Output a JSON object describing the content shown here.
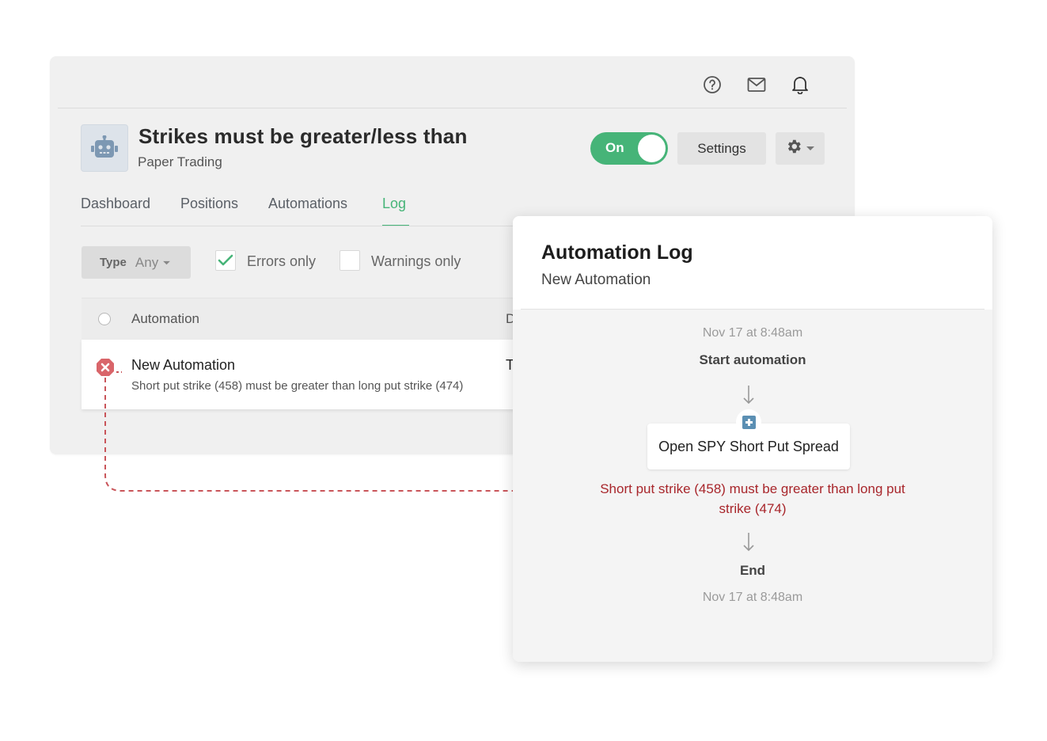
{
  "strategy": {
    "title": "Strikes must be greater/less than",
    "subtitle": "Paper Trading",
    "toggle_label": "On",
    "settings_label": "Settings"
  },
  "topbar": {
    "icons": [
      "help-circle-icon",
      "mail-icon",
      "bell-icon"
    ]
  },
  "tabs": [
    {
      "label": "Dashboard",
      "active": false
    },
    {
      "label": "Positions",
      "active": false
    },
    {
      "label": "Automations",
      "active": false
    },
    {
      "label": "Log",
      "active": true
    }
  ],
  "filters": {
    "type_key": "Type",
    "type_value": "Any",
    "errors_only": {
      "label": "Errors only",
      "checked": true
    },
    "warnings_only": {
      "label": "Warnings only",
      "checked": false
    }
  },
  "table": {
    "columns": [
      "Automation",
      "D"
    ],
    "rows": [
      {
        "title": "New Automation",
        "message": "Short put strike (458) must be greater than long put strike (474)",
        "date_fragment": "T",
        "status": "error"
      }
    ]
  },
  "log_modal": {
    "title": "Automation Log",
    "subtitle": "New Automation",
    "start_time": "Nov 17 at 8:48am",
    "start_label": "Start automation",
    "action_label": "Open SPY Short Put Spread",
    "error_line1": "Short put strike (458) must be greater than long put",
    "error_line2": "strike (474)",
    "end_label": "End",
    "end_time": "Nov 17 at 8:48am"
  },
  "colors": {
    "accent_green": "#46b478",
    "error_red": "#a8262b",
    "connector_red": "#c9555a"
  }
}
